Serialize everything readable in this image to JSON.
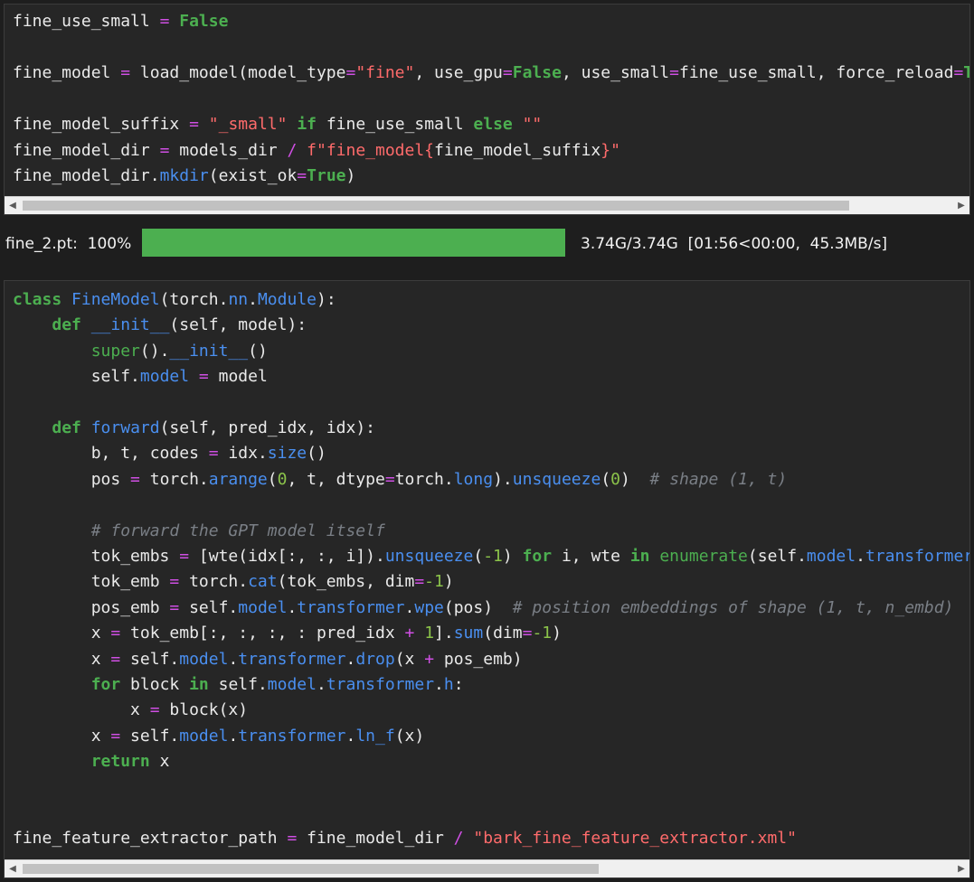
{
  "cells": [
    {
      "lines": [
        [
          [
            "fine_use_small",
            ""
          ],
          [
            " ",
            ""
          ],
          [
            "=",
            "op"
          ],
          [
            " ",
            ""
          ],
          [
            "False",
            "kw"
          ]
        ],
        [],
        [
          [
            "fine_model",
            ""
          ],
          [
            " ",
            ""
          ],
          [
            "=",
            "op"
          ],
          [
            " load_model(model_type",
            ""
          ],
          [
            "=",
            "op"
          ],
          [
            "\"fine\"",
            "str"
          ],
          [
            ", use_gpu",
            ""
          ],
          [
            "=",
            "op"
          ],
          [
            "False",
            "kw"
          ],
          [
            ", use_small",
            ""
          ],
          [
            "=",
            "op"
          ],
          [
            "fine_use_small, force_reload",
            ""
          ],
          [
            "=",
            "op"
          ],
          [
            "True",
            "kw"
          ],
          [
            ")",
            ""
          ]
        ],
        [],
        [
          [
            "fine_model_suffix",
            ""
          ],
          [
            " ",
            ""
          ],
          [
            "=",
            "op"
          ],
          [
            " ",
            ""
          ],
          [
            "\"_small\"",
            "str"
          ],
          [
            " ",
            ""
          ],
          [
            "if",
            "kw"
          ],
          [
            " fine_use_small ",
            ""
          ],
          [
            "else",
            "kw"
          ],
          [
            " ",
            ""
          ],
          [
            "\"\"",
            "str"
          ]
        ],
        [
          [
            "fine_model_dir",
            ""
          ],
          [
            " ",
            ""
          ],
          [
            "=",
            "op"
          ],
          [
            " models_dir ",
            ""
          ],
          [
            "/",
            "op"
          ],
          [
            " ",
            ""
          ],
          [
            "f\"fine_model{",
            "str"
          ],
          [
            "fine_model_suffix",
            ""
          ],
          [
            "}\"",
            "str"
          ]
        ],
        [
          [
            "fine_model_dir.",
            ""
          ],
          [
            "mkdir",
            "fn"
          ],
          [
            "(exist_ok",
            ""
          ],
          [
            "=",
            "op"
          ],
          [
            "True",
            "kw"
          ],
          [
            ")",
            ""
          ]
        ]
      ]
    },
    {
      "lines": [
        [
          [
            "class",
            "kw"
          ],
          [
            " ",
            ""
          ],
          [
            "FineModel",
            "fn"
          ],
          [
            "(torch.",
            ""
          ],
          [
            "nn",
            "fn"
          ],
          [
            ".",
            ""
          ],
          [
            "Module",
            "fn"
          ],
          [
            "):",
            ""
          ]
        ],
        [
          [
            "    ",
            ""
          ],
          [
            "def",
            "kw"
          ],
          [
            " ",
            ""
          ],
          [
            "__init__",
            "fn"
          ],
          [
            "(self, model):",
            ""
          ]
        ],
        [
          [
            "        ",
            ""
          ],
          [
            "super",
            "bi"
          ],
          [
            "().",
            ""
          ],
          [
            "__init__",
            "fn"
          ],
          [
            "()",
            ""
          ]
        ],
        [
          [
            "        self.",
            ""
          ],
          [
            "model",
            "fn"
          ],
          [
            " ",
            ""
          ],
          [
            "=",
            "op"
          ],
          [
            " model",
            ""
          ]
        ],
        [],
        [
          [
            "    ",
            ""
          ],
          [
            "def",
            "kw"
          ],
          [
            " ",
            ""
          ],
          [
            "forward",
            "fn"
          ],
          [
            "(self, pred_idx, idx):",
            ""
          ]
        ],
        [
          [
            "        b, t, codes ",
            ""
          ],
          [
            "=",
            "op"
          ],
          [
            " idx.",
            ""
          ],
          [
            "size",
            "fn"
          ],
          [
            "()",
            ""
          ]
        ],
        [
          [
            "        pos ",
            ""
          ],
          [
            "=",
            "op"
          ],
          [
            " torch.",
            ""
          ],
          [
            "arange",
            "fn"
          ],
          [
            "(",
            ""
          ],
          [
            "0",
            "num"
          ],
          [
            ", t, dtype",
            ""
          ],
          [
            "=",
            "op"
          ],
          [
            "torch.",
            ""
          ],
          [
            "long",
            "fn"
          ],
          [
            ").",
            ""
          ],
          [
            "unsqueeze",
            "fn"
          ],
          [
            "(",
            ""
          ],
          [
            "0",
            "num"
          ],
          [
            ")  ",
            ""
          ],
          [
            "# shape (1, t)",
            "cm"
          ]
        ],
        [],
        [
          [
            "        ",
            ""
          ],
          [
            "# forward the GPT model itself",
            "cm"
          ]
        ],
        [
          [
            "        tok_embs ",
            ""
          ],
          [
            "=",
            "op"
          ],
          [
            " [wte(idx[:, :, i]).",
            ""
          ],
          [
            "unsqueeze",
            "fn"
          ],
          [
            "(",
            ""
          ],
          [
            "-1",
            "num"
          ],
          [
            ") ",
            ""
          ],
          [
            "for",
            "kw"
          ],
          [
            " i, wte ",
            ""
          ],
          [
            "in",
            "kw"
          ],
          [
            " ",
            ""
          ],
          [
            "enumerate",
            "bi"
          ],
          [
            "(self.",
            ""
          ],
          [
            "model",
            "fn"
          ],
          [
            ".",
            ""
          ],
          [
            "transformer",
            "fn"
          ],
          [
            ".",
            ""
          ],
          [
            "wtes",
            "fn"
          ],
          [
            ")]",
            ""
          ]
        ],
        [
          [
            "        tok_emb ",
            ""
          ],
          [
            "=",
            "op"
          ],
          [
            " torch.",
            ""
          ],
          [
            "cat",
            "fn"
          ],
          [
            "(tok_embs, dim",
            ""
          ],
          [
            "=",
            "op"
          ],
          [
            "-1",
            "num"
          ],
          [
            ")",
            ""
          ]
        ],
        [
          [
            "        pos_emb ",
            ""
          ],
          [
            "=",
            "op"
          ],
          [
            " self.",
            ""
          ],
          [
            "model",
            "fn"
          ],
          [
            ".",
            ""
          ],
          [
            "transformer",
            "fn"
          ],
          [
            ".",
            ""
          ],
          [
            "wpe",
            "fn"
          ],
          [
            "(pos)  ",
            ""
          ],
          [
            "# position embeddings of shape (1, t, n_embd)",
            "cm"
          ]
        ],
        [
          [
            "        x ",
            ""
          ],
          [
            "=",
            "op"
          ],
          [
            " tok_emb[:, :, :, : pred_idx ",
            ""
          ],
          [
            "+",
            "op"
          ],
          [
            " ",
            ""
          ],
          [
            "1",
            "num"
          ],
          [
            "].",
            ""
          ],
          [
            "sum",
            "fn"
          ],
          [
            "(dim",
            ""
          ],
          [
            "=",
            "op"
          ],
          [
            "-1",
            "num"
          ],
          [
            ")",
            ""
          ]
        ],
        [
          [
            "        x ",
            ""
          ],
          [
            "=",
            "op"
          ],
          [
            " self.",
            ""
          ],
          [
            "model",
            "fn"
          ],
          [
            ".",
            ""
          ],
          [
            "transformer",
            "fn"
          ],
          [
            ".",
            ""
          ],
          [
            "drop",
            "fn"
          ],
          [
            "(x ",
            ""
          ],
          [
            "+",
            "op"
          ],
          [
            " pos_emb)",
            ""
          ]
        ],
        [
          [
            "        ",
            ""
          ],
          [
            "for",
            "kw"
          ],
          [
            " block ",
            ""
          ],
          [
            "in",
            "kw"
          ],
          [
            " self.",
            ""
          ],
          [
            "model",
            "fn"
          ],
          [
            ".",
            ""
          ],
          [
            "transformer",
            "fn"
          ],
          [
            ".",
            ""
          ],
          [
            "h",
            "fn"
          ],
          [
            ":",
            ""
          ]
        ],
        [
          [
            "            x ",
            ""
          ],
          [
            "=",
            "op"
          ],
          [
            " block(x)",
            ""
          ]
        ],
        [
          [
            "        x ",
            ""
          ],
          [
            "=",
            "op"
          ],
          [
            " self.",
            ""
          ],
          [
            "model",
            "fn"
          ],
          [
            ".",
            ""
          ],
          [
            "transformer",
            "fn"
          ],
          [
            ".",
            ""
          ],
          [
            "ln_f",
            "fn"
          ],
          [
            "(x)",
            ""
          ]
        ],
        [
          [
            "        ",
            ""
          ],
          [
            "return",
            "kw"
          ],
          [
            " x",
            ""
          ]
        ],
        [],
        [],
        [
          [
            "fine_feature_extractor_path ",
            ""
          ],
          [
            "=",
            "op"
          ],
          [
            " fine_model_dir ",
            ""
          ],
          [
            "/",
            "op"
          ],
          [
            " ",
            ""
          ],
          [
            "\"bark_fine_feature_extractor.xml\"",
            "str"
          ]
        ]
      ]
    }
  ],
  "output": {
    "label": "fine_2.pt:  100%",
    "progress": 1.0,
    "stats": "3.74G/3.74G  [01:56<00:00,  45.3MB/s]",
    "bar_color": "#4caf50"
  },
  "scroll_icons": {
    "left": "scroll-left-arrow-icon",
    "right": "scroll-right-arrow-icon"
  },
  "scrollbars": [
    {
      "thumb_fraction": 0.89,
      "scroll_position": 0.0
    },
    {
      "thumb_fraction": 0.62,
      "scroll_position": 0.0
    }
  ]
}
